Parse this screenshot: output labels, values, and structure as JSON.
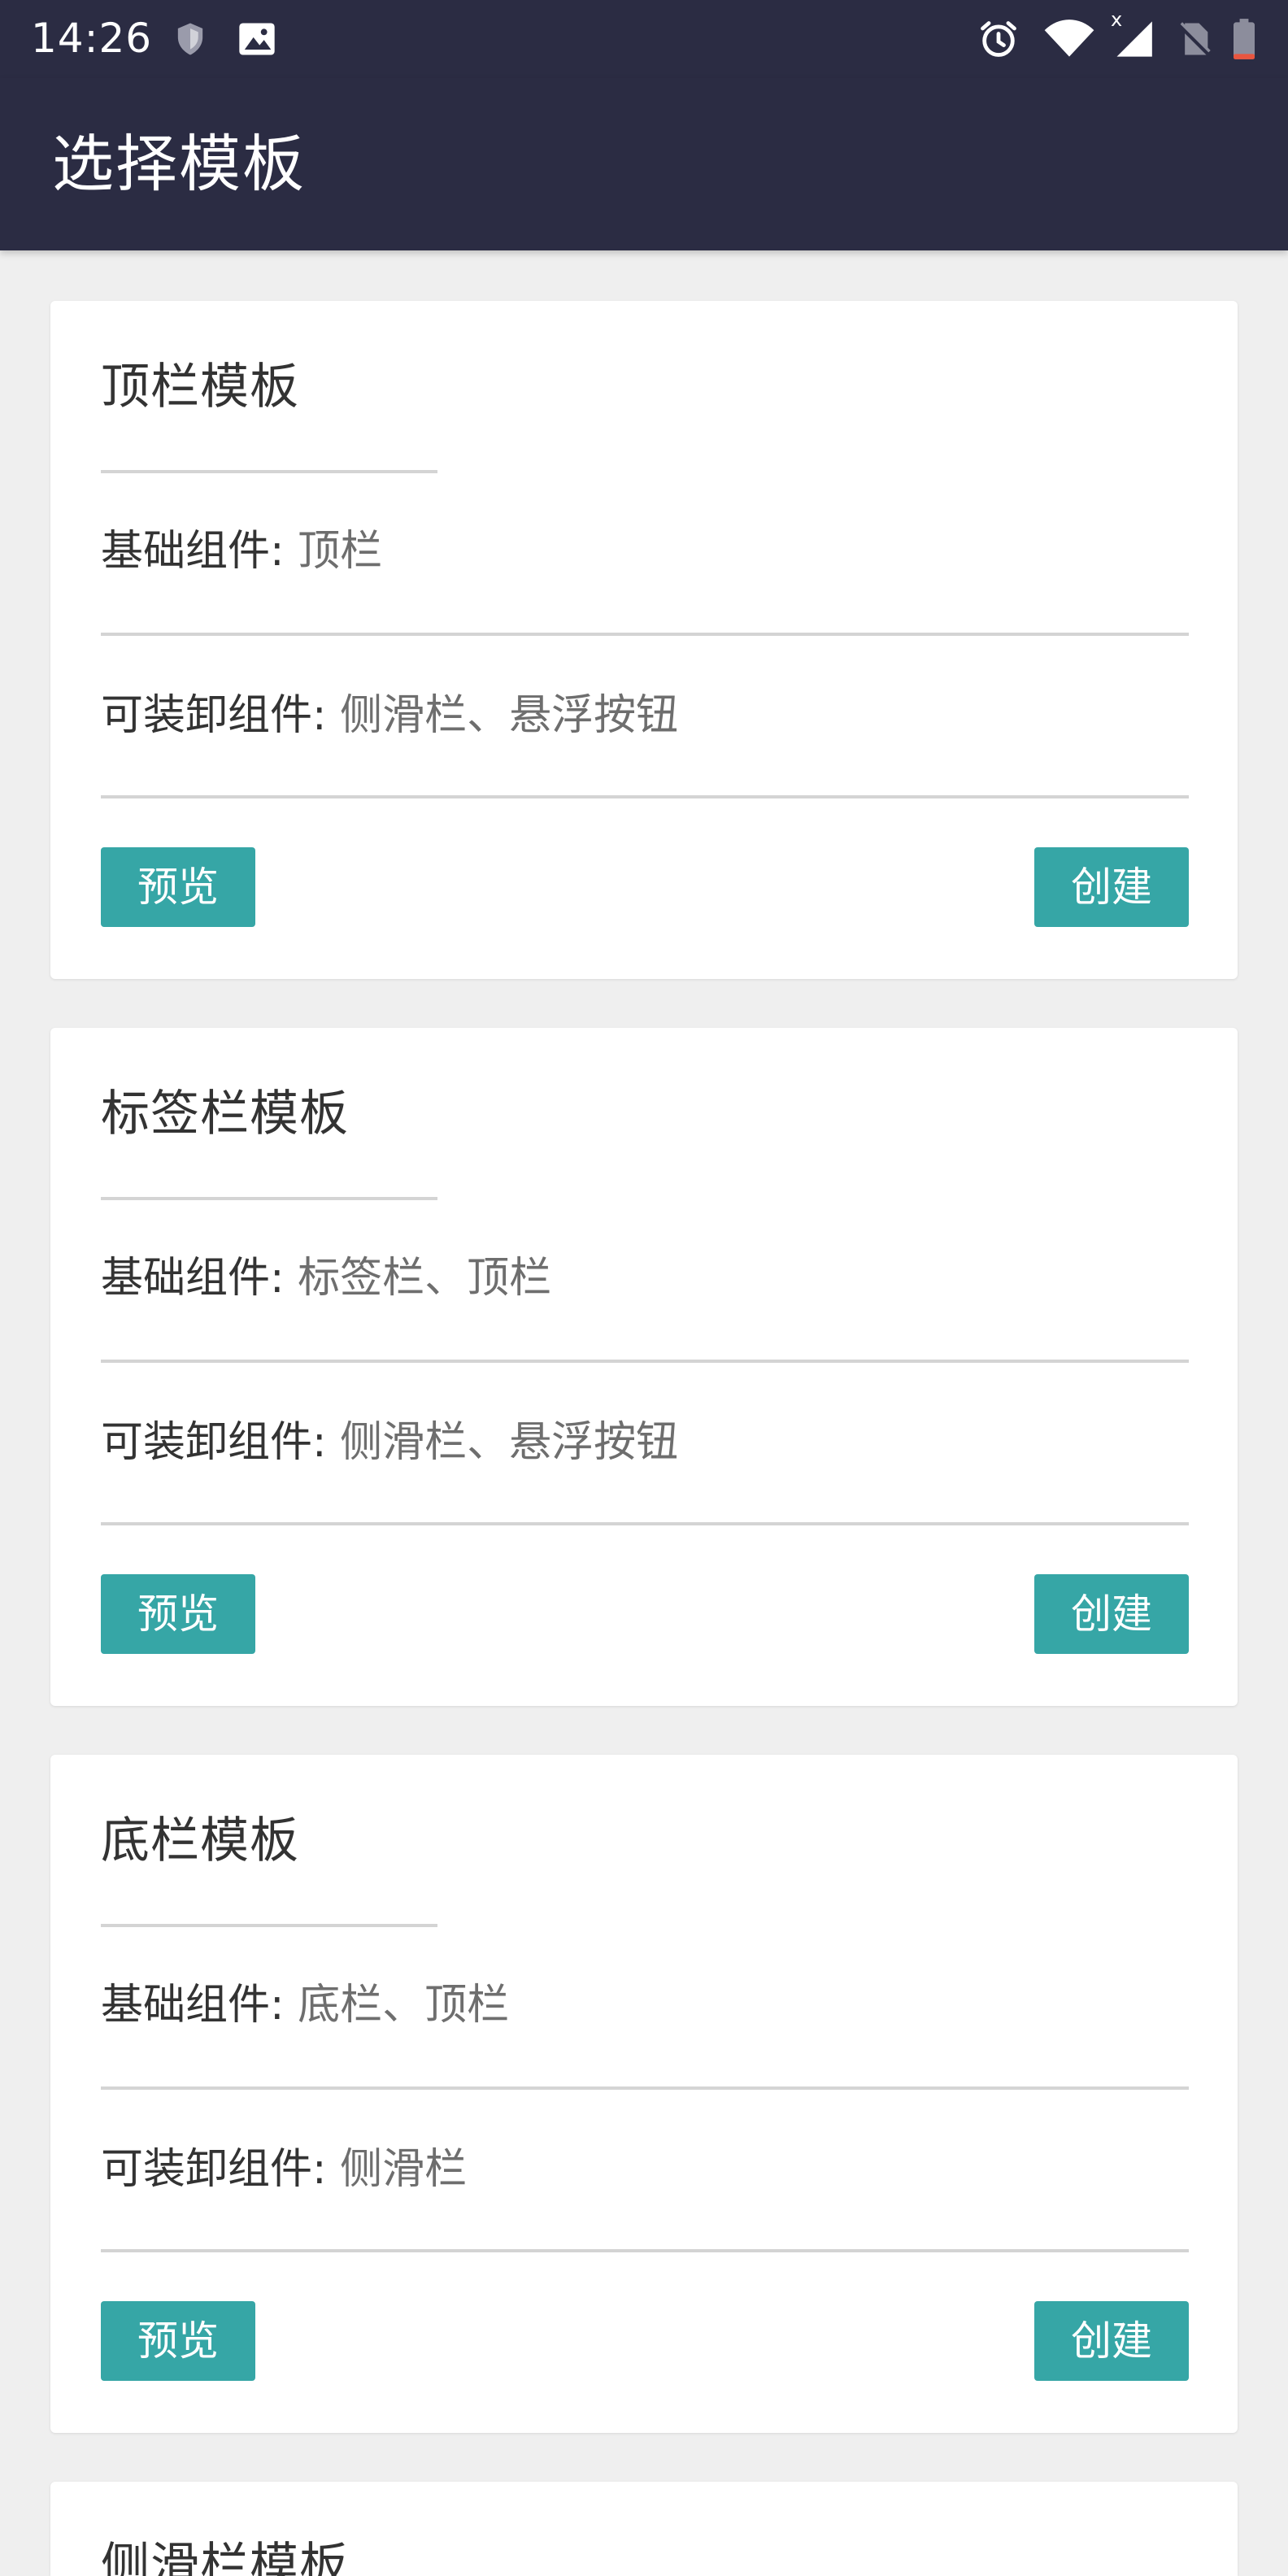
{
  "status_bar": {
    "time": "14:26",
    "icons": [
      "shield-icon",
      "image-icon",
      "alarm-icon",
      "wifi-icon",
      "signal-icon",
      "no-sim-icon",
      "battery-icon"
    ],
    "signal_badge": "x"
  },
  "app_bar": {
    "title": "选择模板"
  },
  "colors": {
    "primary": "#2b2c43",
    "button": "#36a6a6",
    "background": "#efefef",
    "battery_low": "#e8553f"
  },
  "templates": [
    {
      "title": "顶栏模板",
      "base_label": "基础组件:",
      "base_value": "顶栏",
      "removable_label": "可装卸组件:",
      "removable_value": "侧滑栏、悬浮按钮",
      "preview_label": "预览",
      "create_label": "创建"
    },
    {
      "title": "标签栏模板",
      "base_label": "基础组件:",
      "base_value": "标签栏、顶栏",
      "removable_label": "可装卸组件:",
      "removable_value": "侧滑栏、悬浮按钮",
      "preview_label": "预览",
      "create_label": "创建"
    },
    {
      "title": "底栏模板",
      "base_label": "基础组件:",
      "base_value": "底栏、顶栏",
      "removable_label": "可装卸组件:",
      "removable_value": "侧滑栏",
      "preview_label": "预览",
      "create_label": "创建"
    },
    {
      "title": "侧滑栏模板"
    }
  ]
}
